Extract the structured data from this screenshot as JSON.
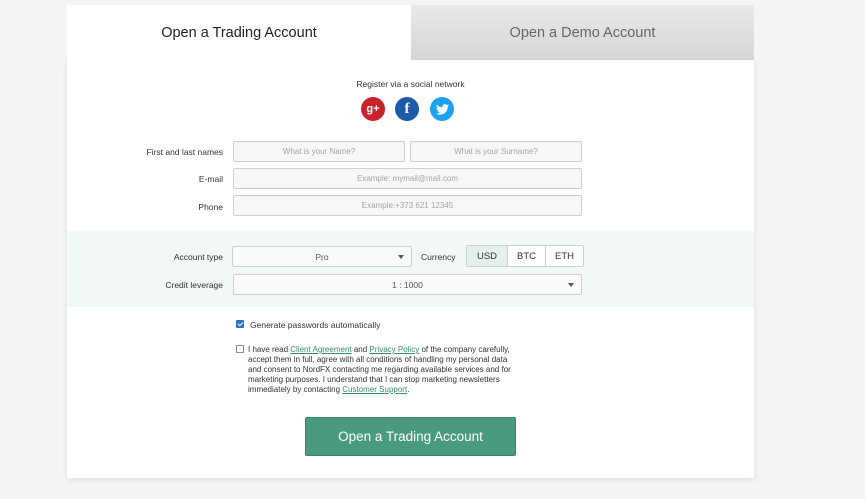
{
  "tabs": {
    "trading": "Open a Trading Account",
    "demo": "Open a Demo Account"
  },
  "social": {
    "title": "Register via a social network",
    "google": "g+",
    "facebook": "f",
    "twitter": "t"
  },
  "form": {
    "name_label": "First and last names",
    "name_placeholder": "What is your Name?",
    "surname_placeholder": "What is your Surname?",
    "email_label": "E-mail",
    "email_placeholder": "Example: mymail@mail.com",
    "phone_label": "Phone",
    "phone_placeholder": "Example:+373 621 12345"
  },
  "account": {
    "type_label": "Account type",
    "type_value": "Pro",
    "currency_label": "Currency",
    "currencies": [
      "USD",
      "BTC",
      "ETH"
    ],
    "selected_currency": "USD",
    "leverage_label": "Credit leverage",
    "leverage_value": "1 : 1000"
  },
  "options": {
    "generate_passwords": "Generate passwords automatically",
    "generate_checked": true,
    "agree_checked": false,
    "agree_1": "I have read ",
    "client_agreement": "Client Agreement",
    "agree_2": " and ",
    "privacy_policy": "Privacy Policy",
    "agree_3": " of the company carefully, accept them in full, agree with all conditions of handling my personal data and consent to NordFX contacting me regarding available services and for marketing purposes. I understand that I can stop marketing newsletters immediately by contacting ",
    "customer_support": "Customer Support",
    "agree_4": "."
  },
  "submit_label": "Open a Trading Account",
  "colors": {
    "accent": "#4a9a80",
    "band": "#f2f7f7",
    "link": "#3a8a6e"
  }
}
